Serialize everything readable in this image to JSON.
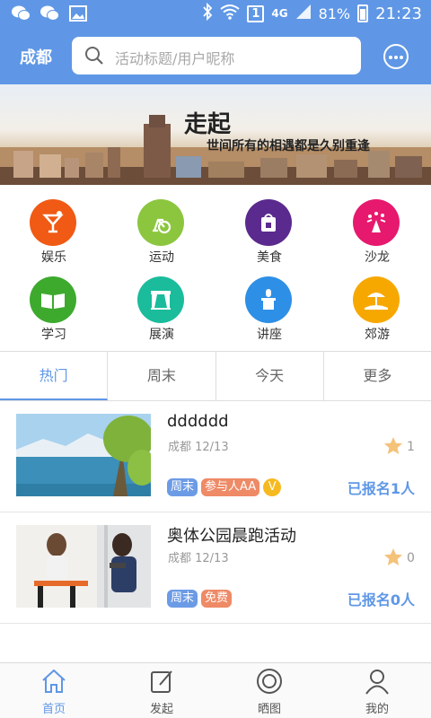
{
  "status_bar": {
    "time": "21:23",
    "battery": "81%",
    "network": "4G",
    "sim": "1",
    "icons": [
      "wechat-icon",
      "wechat-icon",
      "image-icon",
      "bluetooth-icon",
      "wifi-icon",
      "signal-icon",
      "battery-icon"
    ]
  },
  "header": {
    "city": "成都",
    "search_placeholder": "活动标题/用户昵称",
    "more_icon": "more-dots-icon"
  },
  "banner": {
    "title": "走起",
    "subtitle": "世间所有的相遇都是久别重逢"
  },
  "categories": [
    {
      "label": "娱乐",
      "color": "#f05a14",
      "icon": "cocktail-icon"
    },
    {
      "label": "运动",
      "color": "#8cc63f",
      "icon": "bike-icon"
    },
    {
      "label": "美食",
      "color": "#5b2a8e",
      "icon": "food-bag-icon"
    },
    {
      "label": "沙龙",
      "color": "#e6196e",
      "icon": "party-icon"
    },
    {
      "label": "学习",
      "color": "#3daa2e",
      "icon": "book-icon"
    },
    {
      "label": "展演",
      "color": "#1abc9c",
      "icon": "stage-icon"
    },
    {
      "label": "讲座",
      "color": "#2e8fe6",
      "icon": "podium-icon"
    },
    {
      "label": "郊游",
      "color": "#f7a800",
      "icon": "beach-icon"
    }
  ],
  "tabs": [
    {
      "label": "热门",
      "active": true
    },
    {
      "label": "周末",
      "active": false
    },
    {
      "label": "今天",
      "active": false
    },
    {
      "label": "更多",
      "active": false
    }
  ],
  "activities": [
    {
      "title": "dddddd",
      "meta": "成都 12/13",
      "tags": [
        "周末",
        "参与人AA",
        "V"
      ],
      "favorites": "1",
      "signup": "已报名1人"
    },
    {
      "title": "奥体公园晨跑活动",
      "meta": "成都 12/13",
      "tags": [
        "周末",
        "免费"
      ],
      "favorites": "0",
      "signup": "已报名0人"
    }
  ],
  "bottom_nav": [
    {
      "label": "首页",
      "icon": "home-icon",
      "active": true
    },
    {
      "label": "发起",
      "icon": "edit-icon",
      "active": false
    },
    {
      "label": "晒图",
      "icon": "camera-icon",
      "active": false
    },
    {
      "label": "我的",
      "icon": "user-icon",
      "active": false
    }
  ],
  "colors": {
    "brand": "#5f97e6",
    "tag_blue": "#6c9be6",
    "tag_orange": "#ee8a66",
    "vip": "#f6b91f",
    "star": "#f5c27a"
  }
}
